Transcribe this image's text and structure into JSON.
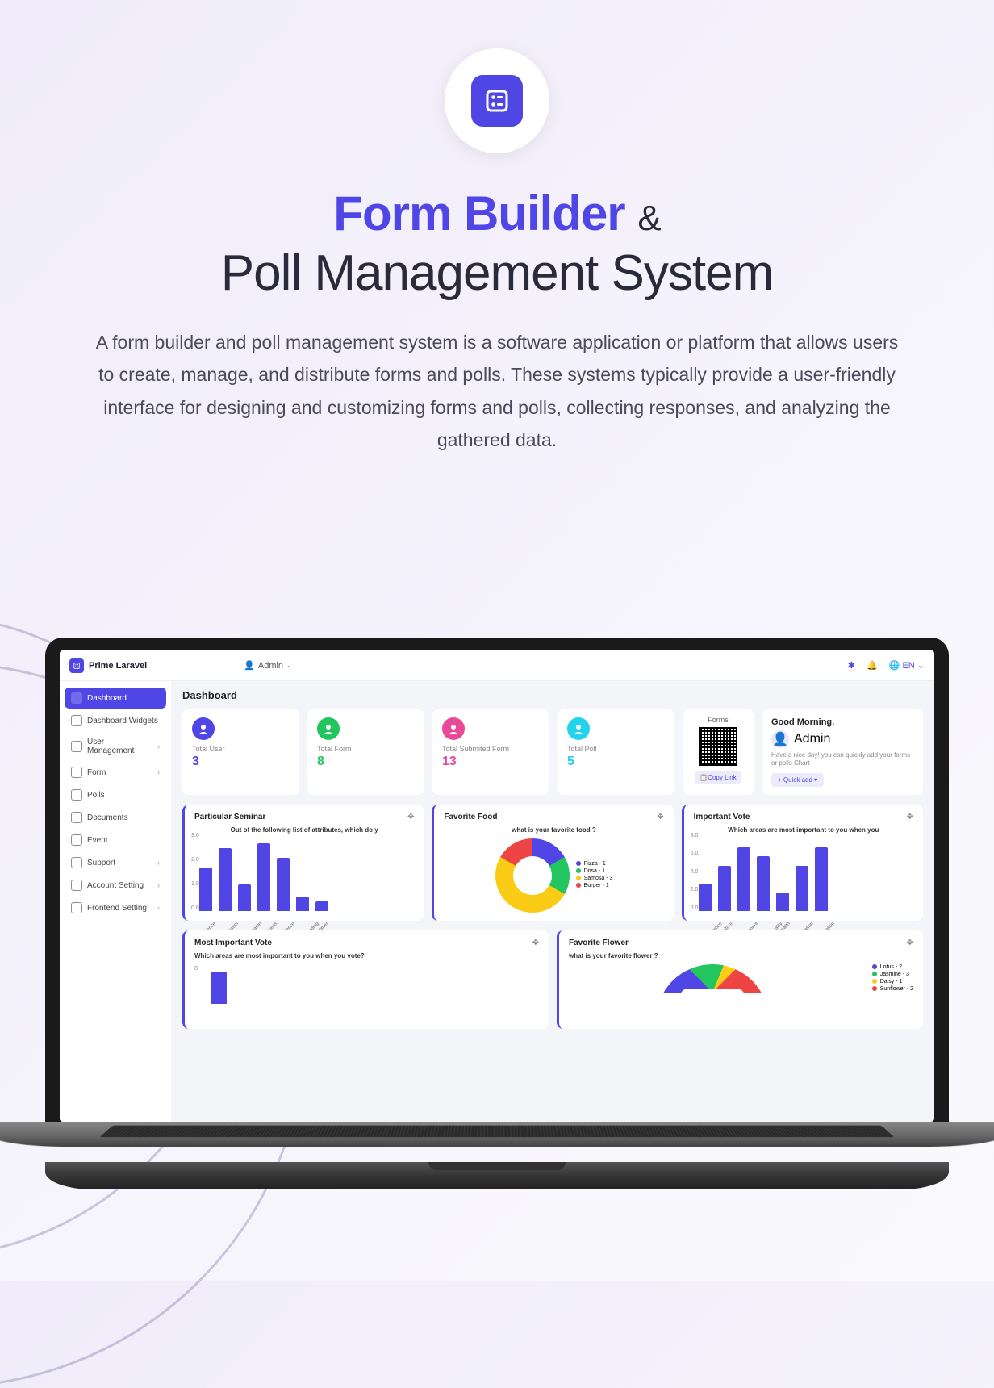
{
  "hero": {
    "title_main": "Form Builder",
    "title_amp": "&",
    "title_sub": "Poll Management System",
    "description": "A form builder and poll management system is a software application or platform that allows users to create, manage, and distribute forms and polls. These systems typically provide a user-friendly interface for designing and customizing forms and polls, collecting responses, and analyzing the gathered data."
  },
  "topbar": {
    "brand": "Prime Laravel",
    "user": "Admin",
    "lang": "EN"
  },
  "sidebar": {
    "items": [
      {
        "label": "Dashboard",
        "active": true,
        "chev": false
      },
      {
        "label": "Dashboard Widgets",
        "active": false,
        "chev": false
      },
      {
        "label": "User Management",
        "active": false,
        "chev": true
      },
      {
        "label": "Form",
        "active": false,
        "chev": true
      },
      {
        "label": "Polls",
        "active": false,
        "chev": false
      },
      {
        "label": "Documents",
        "active": false,
        "chev": false
      },
      {
        "label": "Event",
        "active": false,
        "chev": false
      },
      {
        "label": "Support",
        "active": false,
        "chev": true
      },
      {
        "label": "Account Setting",
        "active": false,
        "chev": true
      },
      {
        "label": "Frontend Setting",
        "active": false,
        "chev": true
      }
    ]
  },
  "page_title": "Dashboard",
  "stats": [
    {
      "label": "Total User",
      "value": "3",
      "color": "#5046e5",
      "vcolor": "#5046e5"
    },
    {
      "label": "Total Form",
      "value": "8",
      "color": "#22c55e",
      "vcolor": "#22c55e"
    },
    {
      "label": "Total Submited Form",
      "value": "13",
      "color": "#ec4899",
      "vcolor": "#ec4899"
    },
    {
      "label": "Total Poll",
      "value": "5",
      "color": "#22d3ee",
      "vcolor": "#22d3ee"
    }
  ],
  "forms_card": {
    "title": "Forms",
    "copy": "Copy Link"
  },
  "greeting": {
    "title": "Good Morning,",
    "user": "Admin",
    "message": "Have a nice day! you can quickly add your forms or polls Chart",
    "quick": "Quick add"
  },
  "charts": {
    "seminar": {
      "title": "Particular Seminar",
      "subtitle": "Out of the following list of attributes, which do y"
    },
    "food": {
      "title": "Favorite Food",
      "subtitle": "what is your favorite food ?"
    },
    "vote": {
      "title": "Important Vote",
      "subtitle": "Which areas are most important to you when you"
    },
    "most_vote": {
      "title": "Most Important Vote",
      "subtitle": "Which areas are most important to you when you vote?"
    },
    "flower": {
      "title": "Favorite Flower",
      "subtitle": "what is your favorite flower ?"
    }
  },
  "chart_data": [
    {
      "type": "bar",
      "id": "seminar",
      "title": "Out of the following list of attributes, which do y",
      "categories": [
        "Patience",
        "Enthusiasm",
        "Knowledgeable",
        "Friendliness",
        "Resilience",
        "Understanding",
        "Other"
      ],
      "values": [
        1.8,
        2.6,
        1.1,
        2.8,
        2.2,
        0.6,
        0.4
      ],
      "ylim": [
        0,
        3
      ],
      "ylabel": "",
      "ticks": [
        0.0,
        1.0,
        2.0,
        3.0
      ]
    },
    {
      "type": "pie",
      "id": "food",
      "title": "what is your favorite food ?",
      "series": [
        {
          "name": "Pizza",
          "value": 1,
          "color": "#5046e5"
        },
        {
          "name": "Dosa",
          "value": 1,
          "color": "#22c55e"
        },
        {
          "name": "Samosa",
          "value": 3,
          "color": "#facc15"
        },
        {
          "name": "Burger",
          "value": 1,
          "color": "#ef4444"
        }
      ]
    },
    {
      "type": "bar",
      "id": "vote",
      "title": "Which areas are most important to you when you",
      "categories": [
        "crime & Justice",
        "Culture",
        "Environment",
        "Family & Equality",
        "Health",
        "Education",
        "Immigration"
      ],
      "values": [
        3,
        5,
        7,
        6,
        2,
        5,
        7
      ],
      "ylim": [
        0,
        8
      ],
      "ticks": [
        0,
        2,
        4,
        6,
        8
      ]
    },
    {
      "type": "bar",
      "id": "most_vote",
      "title": "Which areas are most important to you when you vote?",
      "categories": [],
      "values": [
        8
      ],
      "ylim": [
        0,
        8
      ]
    },
    {
      "type": "pie",
      "id": "flower",
      "title": "what is your favorite flower ?",
      "series": [
        {
          "name": "Lotus",
          "value": 2,
          "color": "#5046e5"
        },
        {
          "name": "Jasmine",
          "value": 3,
          "color": "#22c55e"
        },
        {
          "name": "Daisy",
          "value": 1,
          "color": "#facc15"
        },
        {
          "name": "Sunflower",
          "value": 2,
          "color": "#ef4444"
        }
      ]
    }
  ]
}
